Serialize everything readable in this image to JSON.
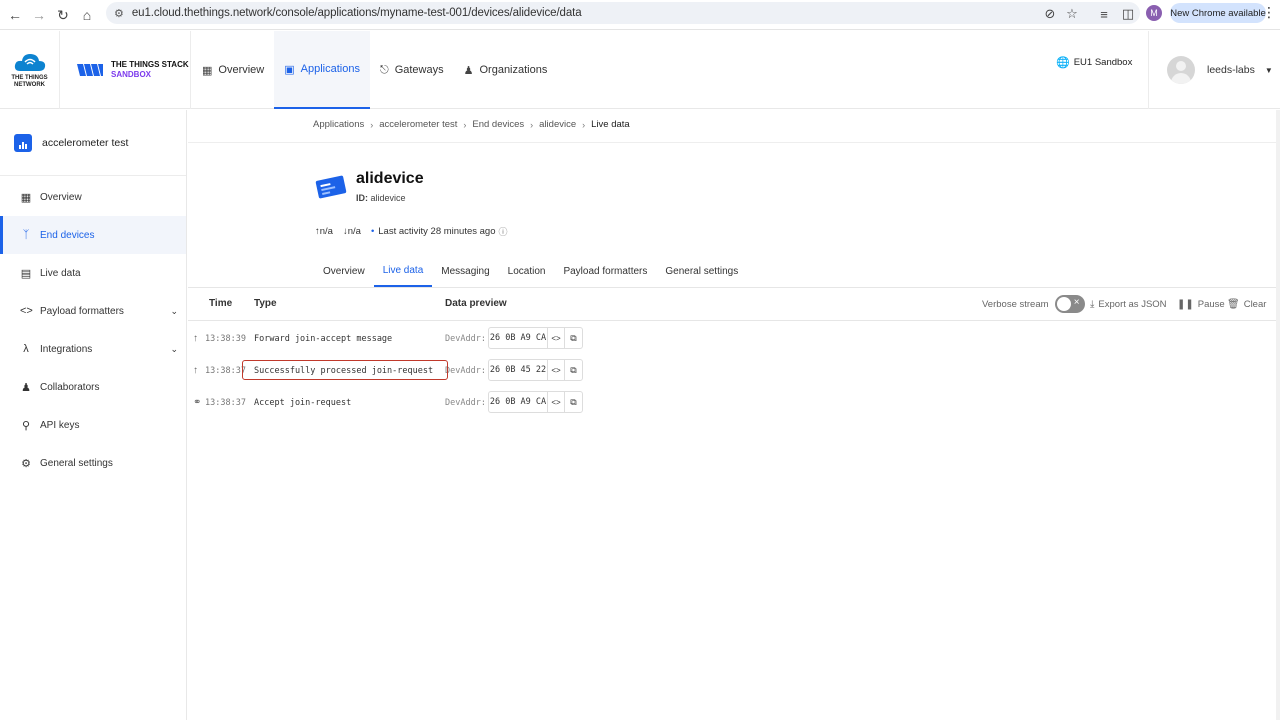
{
  "browser": {
    "url": "eu1.cloud.thethings.network/console/applications/myname-test-001/devices/alidevice/data",
    "profile_initial": "M",
    "update_label": "New Chrome available"
  },
  "header": {
    "ttn_logo_text": "THE THINGS NETWORK",
    "tts_line1": "THE THINGS STACK",
    "tts_line2": "SANDBOX",
    "nav": [
      {
        "label": "Overview"
      },
      {
        "label": "Applications"
      },
      {
        "label": "Gateways"
      },
      {
        "label": "Organizations"
      }
    ],
    "cluster": "EU1 Sandbox",
    "user": "leeds-labs"
  },
  "sidebar": {
    "app_name": "accelerometer test",
    "items": [
      {
        "label": "Overview"
      },
      {
        "label": "End devices"
      },
      {
        "label": "Live data"
      },
      {
        "label": "Payload formatters"
      },
      {
        "label": "Integrations"
      },
      {
        "label": "Collaborators"
      },
      {
        "label": "API keys"
      },
      {
        "label": "General settings"
      }
    ]
  },
  "breadcrumb": [
    "Applications",
    "accelerometer test",
    "End devices",
    "alidevice",
    "Live data"
  ],
  "device": {
    "name": "alidevice",
    "id_label": "ID:",
    "id_value": "alidevice",
    "uplink": "n/a",
    "downlink": "n/a",
    "last_activity": "Last activity 28 minutes ago"
  },
  "tabs": [
    "Overview",
    "Live data",
    "Messaging",
    "Location",
    "Payload formatters",
    "General settings"
  ],
  "table": {
    "col_time": "Time",
    "col_type": "Type",
    "col_preview": "Data preview",
    "verbose": "Verbose stream",
    "export": "Export as JSON",
    "pause": "Pause",
    "clear": "Clear",
    "rows": [
      {
        "time": "13:38:39",
        "type": "Forward join-accept message",
        "label": "DevAddr:",
        "value": "26 0B A9 CA"
      },
      {
        "time": "13:38:37",
        "type": "Successfully processed join-request",
        "label": "DevAddr:",
        "value": "26 0B 45 22"
      },
      {
        "time": "13:38:37",
        "type": "Accept join-request",
        "label": "DevAddr:",
        "value": "26 0B A9 CA"
      }
    ]
  },
  "colors": {
    "accent": "#1c62e8",
    "brand_purple": "#7c3aed",
    "highlight": "#c0392b"
  }
}
